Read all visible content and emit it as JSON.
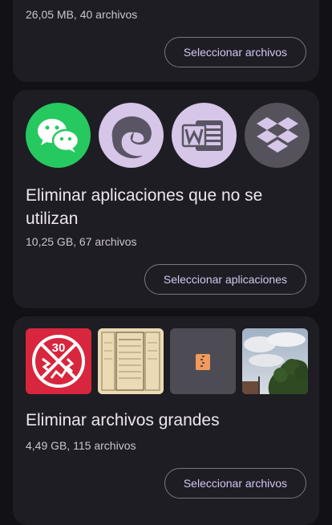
{
  "top_card": {
    "meta": "26,05 MB, 40 archivos",
    "button_label": "Seleccionar archivos"
  },
  "apps_card": {
    "icons": [
      "wechat-icon",
      "edge-icon",
      "word-icon",
      "dropbox-icon"
    ],
    "title": "Eliminar aplicaciones que no se utilizan",
    "meta": "10,25 GB, 67 archivos",
    "button_label": "Seleccionar aplicaciones"
  },
  "large_files_card": {
    "thumbnails": [
      "speed-limit-sign",
      "document-scan",
      "zip-file",
      "sky-tree-photo"
    ],
    "title": "Eliminar archivos grandes",
    "meta": "4,49 GB, 115 archivos",
    "button_label": "Seleccionar archivos"
  },
  "colors": {
    "background": "#121116",
    "card": "#1e1d23",
    "accent": "#d3c7f2",
    "wechat_green": "#26c95f",
    "icon_lavender": "#d6c6e8"
  }
}
